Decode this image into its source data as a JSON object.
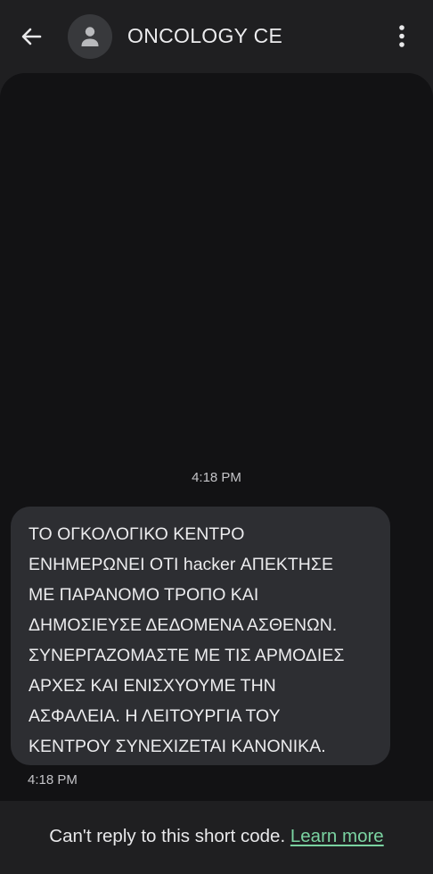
{
  "header": {
    "title": "ONCOLOGY CE",
    "back_icon": "arrow-left-icon",
    "avatar_icon": "person-icon",
    "menu_icon": "more-vertical-icon"
  },
  "conversation": {
    "top_timestamp": "4:18 PM",
    "message": {
      "text": "ΤΟ ΟΓΚΟΛΟΓΙΚΟ ΚΕΝΤΡΟ\nΕΝΗΜΕΡΩΝΕΙ ΟΤΙ hacker ΑΠΕΚΤΗΣΕ\nΜΕ ΠΑΡΑΝΟΜΟ ΤΡΟΠΟ ΚΑΙ\nΔΗΜΟΣΙΕΥΣΕ ΔΕΔΟΜΕΝΑ ΑΣΘΕΝΩΝ.\nΣΥΝΕΡΓΑΖΟΜΑΣΤΕ ΜΕ ΤΙΣ ΑΡΜΟΔΙΕΣ\nΑΡΧΕΣ ΚΑΙ ΕΝΙΣΧΥΟΥΜΕ ΤΗΝ\nΑΣΦΑΛΕΙΑ. Η ΛΕΙΤΟΥΡΓΙΑ ΤΟΥ\nΚΕΝΤΡΟΥ ΣΥΝΕΧΙΖΕΤΑΙ ΚΑΝΟΝΙΚΑ.",
      "timestamp": "4:18 PM"
    }
  },
  "footer": {
    "notice": "Can't reply to this short code.",
    "link_label": "Learn more"
  },
  "colors": {
    "background": "#1f1f21",
    "conversation_bg": "#121214",
    "bubble_bg": "#2d2e32",
    "link": "#7ad3a1"
  }
}
